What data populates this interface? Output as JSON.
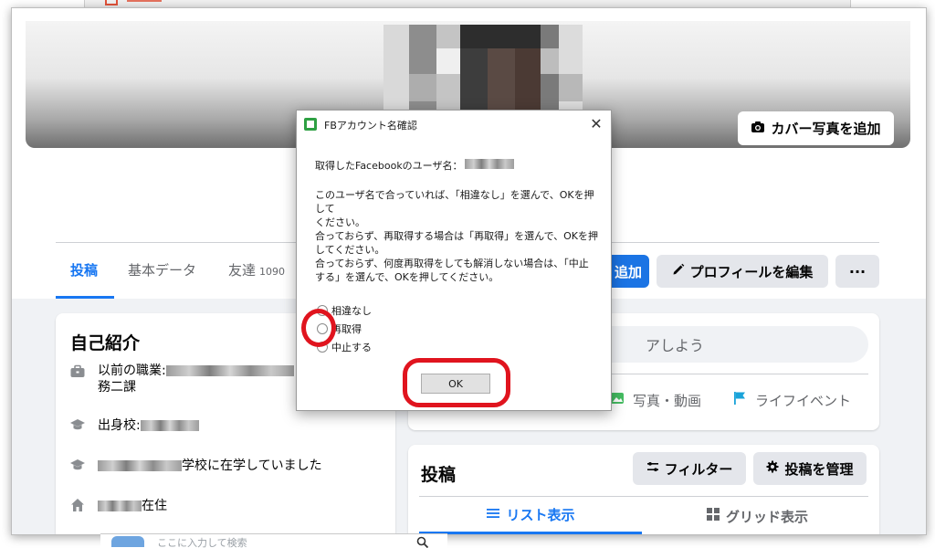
{
  "background_window": {
    "logo_text": "■ Path"
  },
  "profile": {
    "cover": {
      "add_cover_label": "カバー写真を追加"
    },
    "tabs": [
      {
        "label": "投稿",
        "active": true
      },
      {
        "label": "基本データ"
      },
      {
        "label": "友達",
        "count": "1090"
      }
    ],
    "actions": {
      "add_story_label": "追加",
      "edit_profile_label": "プロフィールを編集",
      "more_label": "···"
    },
    "intro": {
      "title": "自己紹介",
      "job_prefix": "以前の職業:",
      "job_suffix": "務二課",
      "hometown_prefix": "出身校:",
      "school_suffix": "学校に在学していました",
      "lives_suffix": "在住"
    },
    "composer": {
      "placeholder_tail": "アしよう",
      "photo_video_label": "写真・動画",
      "life_event_label": "ライフイベント"
    },
    "posts": {
      "title": "投稿",
      "filter_label": "フィルター",
      "manage_label": "投稿を管理",
      "list_view_label": "リスト表示",
      "grid_view_label": "グリッド表示"
    }
  },
  "bottom_search": {
    "placeholder": "ここに入力して検索"
  },
  "dialog": {
    "title": "FBアカウント名確認",
    "close_label": "✕",
    "username_label": "取得したFacebookのユーザ名：",
    "message": "このユーザ名で合っていれば、「相違なし」を選んで、OKを押して\nください。\n合っておらず、再取得する場合は「再取得」を選んで、OKを押\nしてください。\n合っておらず、何度再取得をしても解消しない場合は、「中止\nする」を選んで、OKを押してください。",
    "options": [
      {
        "label": "相違なし"
      },
      {
        "label": "再取得"
      },
      {
        "label": "中止する"
      }
    ],
    "ok_label": "OK"
  },
  "annotations": {
    "highlight_color": "#e0141e"
  },
  "colors": {
    "facebook_blue": "#1877f2",
    "page_background": "#f0f2f5"
  }
}
